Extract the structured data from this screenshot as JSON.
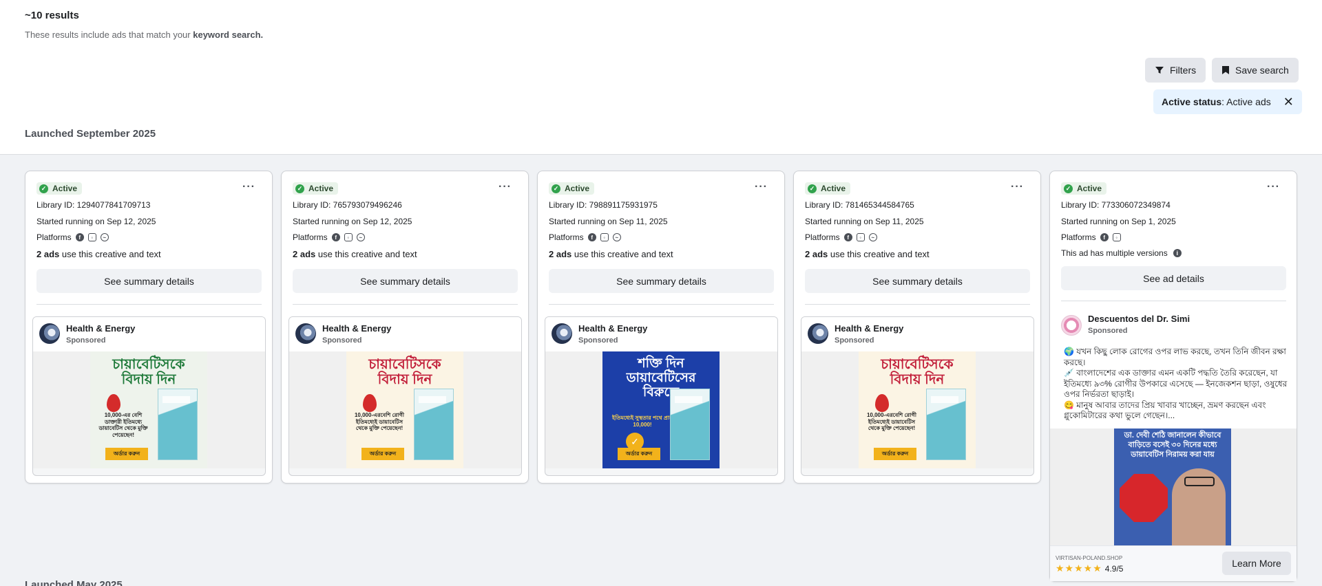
{
  "header": {
    "results_count": "~10 results",
    "results_sub_prefix": "These results include ads that match your ",
    "results_sub_bold": "keyword search."
  },
  "toolbar": {
    "filters_label": "Filters",
    "save_search_label": "Save search",
    "filters_icon": "filter-icon",
    "save_icon": "bookmark-icon"
  },
  "active_filter": {
    "key": "Active status",
    "value": ": Active ads"
  },
  "sections": {
    "launched_1": "Launched September 2025",
    "launched_2": "Launched May 2025"
  },
  "cards": [
    {
      "status": "Active",
      "library_id": "Library ID: 1294077841709713",
      "started": "Started running on Sep 12, 2025",
      "platforms_label": "Platforms",
      "ads_count": "2 ads",
      "ads_text": " use this creative and text",
      "button": "See summary details",
      "page_name": "Health & Energy",
      "sponsored": "Sponsored",
      "creative_title": "চায়াবেটিসকে বিদায় দিন",
      "creative_small": "10,000-এর বেশি ডাক্তারী ইতিমধ্যে ডায়াবেটিস থেকে মুক্তি পেয়েছেন!",
      "creative_cta": "অর্ডার করুন"
    },
    {
      "status": "Active",
      "library_id": "Library ID: 765793079496246",
      "started": "Started running on Sep 12, 2025",
      "platforms_label": "Platforms",
      "ads_count": "2 ads",
      "ads_text": " use this creative and text",
      "button": "See summary details",
      "page_name": "Health & Energy",
      "sponsored": "Sponsored",
      "creative_title": "চায়াবেটিসকে বিদায় দিন",
      "creative_small": "10,000-এরবেশি রোগী ইতিমধ্যেই ডায়াবেটিস থেকে মুক্তি পেয়েছেন!",
      "creative_cta": "অর্ডার করুন"
    },
    {
      "status": "Active",
      "library_id": "Library ID: 798891175931975",
      "started": "Started running on Sep 11, 2025",
      "platforms_label": "Platforms",
      "ads_count": "2 ads",
      "ads_text": " use this creative and text",
      "button": "See summary details",
      "page_name": "Health & Energy",
      "sponsored": "Sponsored",
      "creative_title": "শক্তি দিন ডায়াবেটিসের বিরুদ্ধে",
      "creative_small": "ইতিমধ্যেই সুস্থতার পথে প্রায় 10,000!",
      "creative_cta": "অর্ডার করুন"
    },
    {
      "status": "Active",
      "library_id": "Library ID: 781465344584765",
      "started": "Started running on Sep 11, 2025",
      "platforms_label": "Platforms",
      "ads_count": "2 ads",
      "ads_text": " use this creative and text",
      "button": "See summary details",
      "page_name": "Health & Energy",
      "sponsored": "Sponsored",
      "creative_title": "চায়াবেটিসকে বিদায় দিন",
      "creative_small": "10,000-এরবেশি রোগী ইতিমধ্যেই ডায়াবেটিস থেকে মুক্তি পেয়েছেন!",
      "creative_cta": "অর্ডার করুন"
    },
    {
      "status": "Active",
      "library_id": "Library ID: 773306072349874",
      "started": "Started running on Sep 1, 2025",
      "platforms_label": "Platforms",
      "multi_versions": "This ad has multiple versions",
      "button": "See ad details",
      "page_name": "Descuentos del Dr. Simi",
      "sponsored": "Sponsored",
      "body": "🌍 যখন কিছু লোক রোগের ওপর লাভ করছে, তখন তিনি জীবন রক্ষা করছে।\n💉 বাংলাদেশের এক ডাক্তার এমন একটি পদ্ধতি তৈরি করেছেন, যা ইতিমধ্যে ৯৩% রোগীর উপকারে এসেছে — ইনজেকশন ছাড়া, ওষুধের ওপর নির্ভরতা ছাড়াই।\n😋 মানুষ আবার তাদের প্রিয় খাবার খাচ্ছেন, ভ্রমণ করছেন এবং গ্লুকোমিটারের কথা ভুলে গেছেন।...",
      "creative_title": "ডা. দেবী শেঠি জানালেন কীভাবে বাড়িতে বসেই ৩০ দিনের মধ্যে ডায়াবেটিস নিরাময় করা যায়",
      "shop": "VIRTISAN-POLAND.SHOP",
      "stars": "★★★★★",
      "rating": "4.9/5",
      "cta": "Learn More"
    }
  ],
  "colors": {
    "active_green": "#31a24c",
    "chip_blue": "#e7f3ff",
    "star_yellow": "#f2b21b"
  }
}
